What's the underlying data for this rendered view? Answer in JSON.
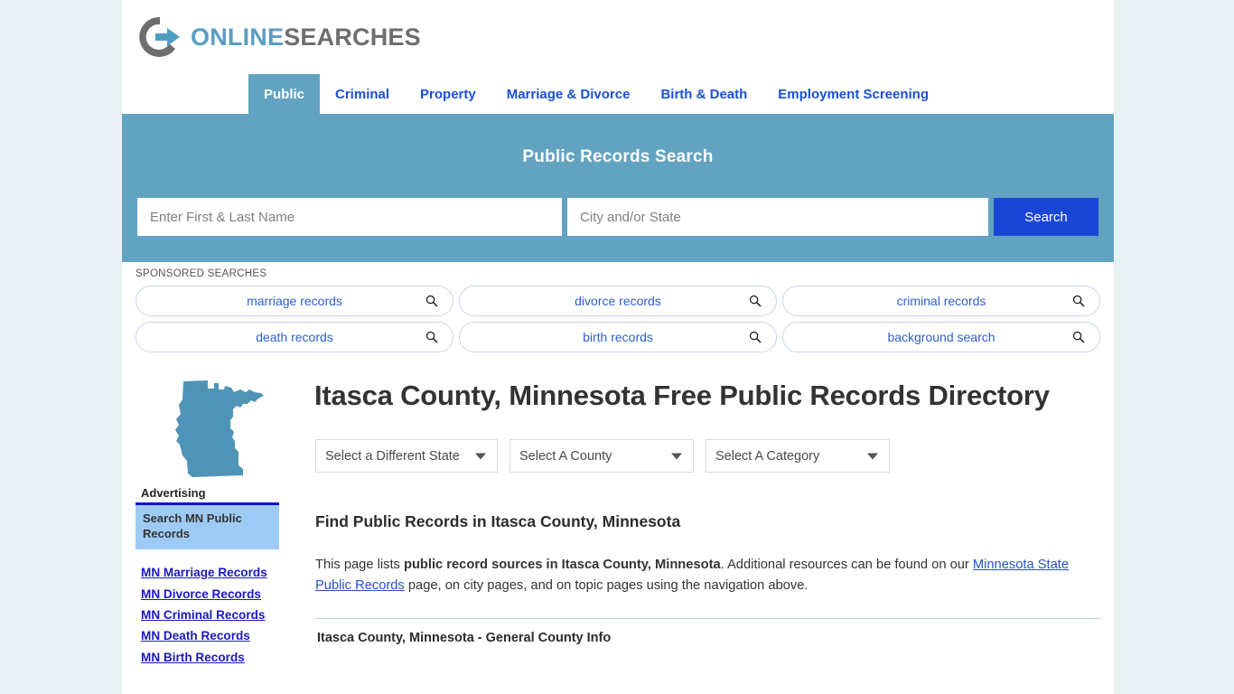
{
  "site": {
    "logo_icon": "circle-arrow-logo-icon",
    "logo_primary": "ONLINE",
    "logo_secondary": "SEARCHES",
    "accent_blue": "#61a3c0",
    "link_blue": "#1a4fd6",
    "search_button_blue": "#1a46d8",
    "page_background": "#eaf1f5"
  },
  "nav": {
    "tabs": [
      {
        "label": "Public",
        "active": true
      },
      {
        "label": "Criminal",
        "active": false
      },
      {
        "label": "Property",
        "active": false
      },
      {
        "label": "Marriage & Divorce",
        "active": false
      },
      {
        "label": "Birth & Death",
        "active": false
      },
      {
        "label": "Employment Screening",
        "active": false
      }
    ]
  },
  "hero": {
    "title": "Public Records Search",
    "name_placeholder": "Enter First & Last Name",
    "name_value": "",
    "city_placeholder": "City and/or State",
    "city_value": "",
    "search_button": "Search"
  },
  "sponsored": {
    "label": "SPONSORED SEARCHES",
    "rows": [
      [
        {
          "label": "marriage records",
          "icon": "magnifier-icon"
        },
        {
          "label": "divorce records",
          "icon": "magnifier-icon"
        },
        {
          "label": "criminal records",
          "icon": "magnifier-icon"
        }
      ],
      [
        {
          "label": "death records",
          "icon": "magnifier-icon"
        },
        {
          "label": "birth records",
          "icon": "magnifier-icon"
        },
        {
          "label": "background search",
          "icon": "magnifier-icon"
        }
      ]
    ]
  },
  "main": {
    "state_map_icon": "minnesota-state-map-icon",
    "page_title": "Itasca County, Minnesota Free Public Records Directory",
    "selects": [
      {
        "label": "Select a Different State"
      },
      {
        "label": "Select A County"
      },
      {
        "label": "Select A Category"
      }
    ],
    "section_heading": "Find Public Records in Itasca County, Minnesota",
    "intro": {
      "part1": "This page lists ",
      "bold": "public record sources in Itasca County, Minnesota",
      "part2": ". Additional resources can be found on our ",
      "link": "Minnesota State Public Records",
      "part3": " page, on city pages, and on topic pages using the navigation above."
    },
    "subsection_heading": "Itasca County, Minnesota - General County Info"
  },
  "sidebar": {
    "advertising_label": "Advertising",
    "ad_box_text": "Search MN Public Records",
    "links": [
      "MN Marriage Records",
      "MN Divorce Records",
      "MN Criminal Records",
      "MN Death Records",
      "MN Birth Records"
    ]
  }
}
